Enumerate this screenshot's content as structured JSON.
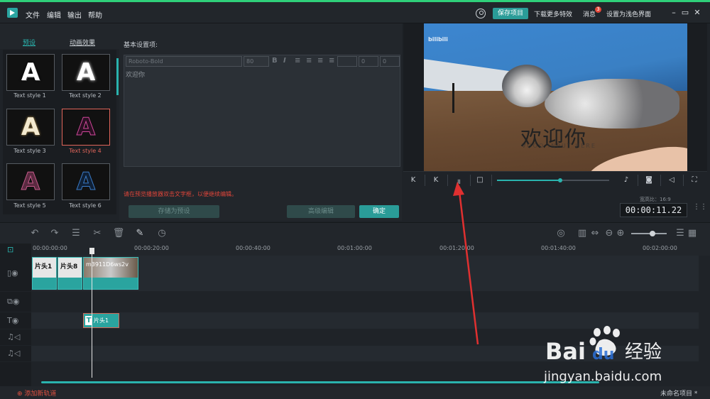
{
  "menubar": {
    "items": [
      "文件",
      "编辑",
      "输出",
      "帮助"
    ],
    "save_project": "保存项目",
    "download_effects": "下载更多特效",
    "messages": "消息",
    "messages_badge": "3",
    "light_theme": "设置为浅色界面"
  },
  "left_panel": {
    "tabs": [
      "预设",
      "动画效果"
    ],
    "styles": [
      {
        "label": "Text style 1"
      },
      {
        "label": "Text style 2"
      },
      {
        "label": "Text style 3"
      },
      {
        "label": "Text style 4"
      },
      {
        "label": "Text style 5"
      },
      {
        "label": "Text style 6"
      }
    ]
  },
  "settings": {
    "title": "基本设置项:",
    "font": "Roboto-Bold",
    "size": "80",
    "num1": "0",
    "num2": "0",
    "num3": "0",
    "text": "欢迎你",
    "hint": "请在预览播放器双击文字框，以便继续编辑。",
    "save_preset": "存储为预设",
    "advanced": "高级编辑",
    "ok": "确定"
  },
  "preview": {
    "caption": "欢迎你",
    "caption_sub": "VOOO INPUT HERE",
    "watermark": "bilibili",
    "aspect_ratio": "宽高比：16:9",
    "timecode": "00:00:11.22",
    "seek_fraction": 0.56
  },
  "timeline": {
    "ticks": [
      "00:00:00:00",
      "00:00:20:00",
      "00:00:40:00",
      "00:01:00:00",
      "00:01:20:00",
      "00:01:40:00",
      "00:02:00:00"
    ],
    "clips": [
      "片头1",
      "片头8",
      "m3911D6ws2v"
    ],
    "title_clip": "片头1",
    "add_track": "添加新轨道",
    "project_name": "未命名项目 *"
  },
  "brand_watermark": {
    "logo": "Bai du 经验",
    "url": "jingyan.baidu.com"
  },
  "colors": {
    "accent": "#2ab3ae",
    "highlight": "#e0655a",
    "arrow": "#e03030"
  }
}
